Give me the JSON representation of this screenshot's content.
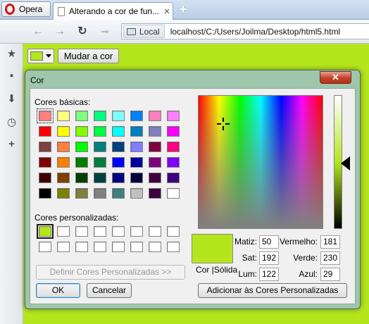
{
  "browser": {
    "menu_label": "Opera",
    "tab_title": "Alterando a cor de fun...",
    "address_badge": "Local",
    "url": "localhost/C:/Users/Joilma/Desktop/html5.html"
  },
  "page": {
    "color_value": "#b5e61d",
    "change_button_label": "Mudar a cor"
  },
  "dialog": {
    "title": "Cor",
    "basic_colors_label": "Cores básicas:",
    "custom_colors_label": "Cores personalizadas:",
    "basic_colors": [
      [
        "#ff8080",
        "#ffff80",
        "#80ff80",
        "#00ff80",
        "#80ffff",
        "#0080ff",
        "#ff80c0",
        "#ff80ff"
      ],
      [
        "#ff0000",
        "#ffff00",
        "#80ff00",
        "#00ff40",
        "#00ffff",
        "#0080c0",
        "#8080c0",
        "#ff00ff"
      ],
      [
        "#804040",
        "#ff8040",
        "#00ff00",
        "#008080",
        "#004080",
        "#8080ff",
        "#800040",
        "#ff0080"
      ],
      [
        "#800000",
        "#ff8000",
        "#008000",
        "#008040",
        "#0000ff",
        "#0000a0",
        "#800080",
        "#8000ff"
      ],
      [
        "#400000",
        "#804000",
        "#004000",
        "#004040",
        "#000080",
        "#000040",
        "#400040",
        "#400080"
      ],
      [
        "#000000",
        "#808000",
        "#808040",
        "#808080",
        "#408080",
        "#c0c0c0",
        "#400040",
        "#ffffff"
      ]
    ],
    "custom_colors": [
      [
        "#b5e61d",
        "#ffffff",
        "#ffffff",
        "#ffffff",
        "#ffffff",
        "#ffffff",
        "#ffffff",
        "#ffffff"
      ],
      [
        "#ffffff",
        "#ffffff",
        "#ffffff",
        "#ffffff",
        "#ffffff",
        "#ffffff",
        "#ffffff",
        "#ffffff"
      ]
    ],
    "define_custom_label": "Definir Cores Personalizadas >>",
    "ok_label": "OK",
    "cancel_label": "Cancelar",
    "preview_label": "Cor  |Sólida",
    "fields": {
      "hue_label": "Matiz:",
      "hue": "50",
      "sat_label": "Sat:",
      "sat": "192",
      "lum_label": "Lum:",
      "lum": "122",
      "red_label": "Vermelho:",
      "red": "181",
      "green_label": "Verde:",
      "green": "230",
      "blue_label": "Azul:",
      "blue": "29"
    },
    "add_custom_label": "Adicionar às Cores Personalizadas"
  }
}
